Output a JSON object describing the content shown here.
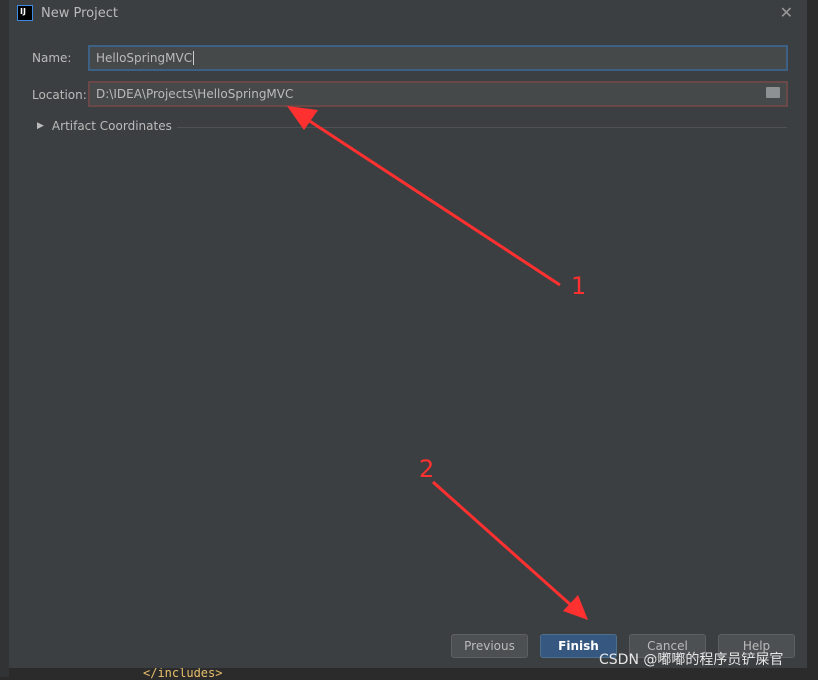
{
  "dialog": {
    "title": "New Project",
    "close_icon": "close-icon",
    "name_label": "Name:",
    "name_value": "HelloSpringMVC",
    "location_label": "Location:",
    "location_value": "D:\\IDEA\\Projects\\HelloSpringMVC",
    "artifact_label": "Artifact Coordinates",
    "buttons": {
      "previous": "Previous",
      "finish": "Finish",
      "cancel": "Cancel",
      "help": "Help"
    }
  },
  "editor": {
    "code_line": "</includes>"
  },
  "annotations": {
    "label1": "1",
    "label2": "2",
    "color": "#ff3030"
  },
  "watermark": "CSDN @嘟嘟的程序员铲屎官"
}
